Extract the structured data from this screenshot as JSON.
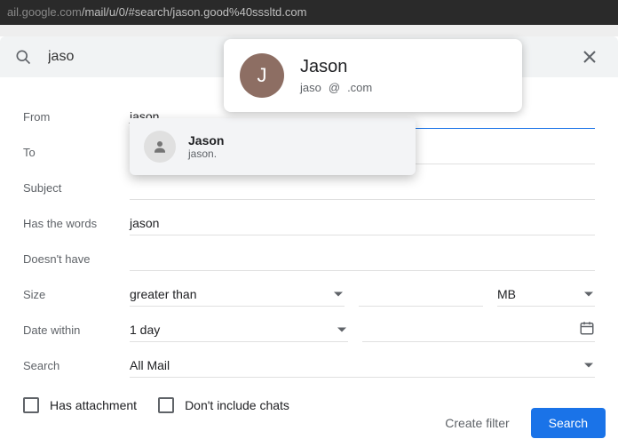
{
  "url": {
    "prefix": "ail.google.com",
    "path": "/mail/u/0/#search/jason.good%40sssltd.com"
  },
  "search": {
    "value": "jaso"
  },
  "popover": {
    "initial": "J",
    "name": "Jason",
    "local": "jaso",
    "at": "@",
    "domain": ".com"
  },
  "form": {
    "from_label": "From",
    "from_value": "jason",
    "to_label": "To",
    "subject_label": "Subject",
    "haswords_label": "Has the words",
    "haswords_value": "jason",
    "doesnt_label": "Doesn't have",
    "size_label": "Size",
    "size_op": "greater than",
    "size_unit": "MB",
    "date_label": "Date within",
    "date_range": "1 day",
    "search_label": "Search",
    "search_scope": "All Mail"
  },
  "checks": {
    "attachment": "Has attachment",
    "nochats": "Don't include chats"
  },
  "suggest": {
    "name": "Jason",
    "email": "jason."
  },
  "actions": {
    "create_filter": "Create filter",
    "search": "Search"
  }
}
